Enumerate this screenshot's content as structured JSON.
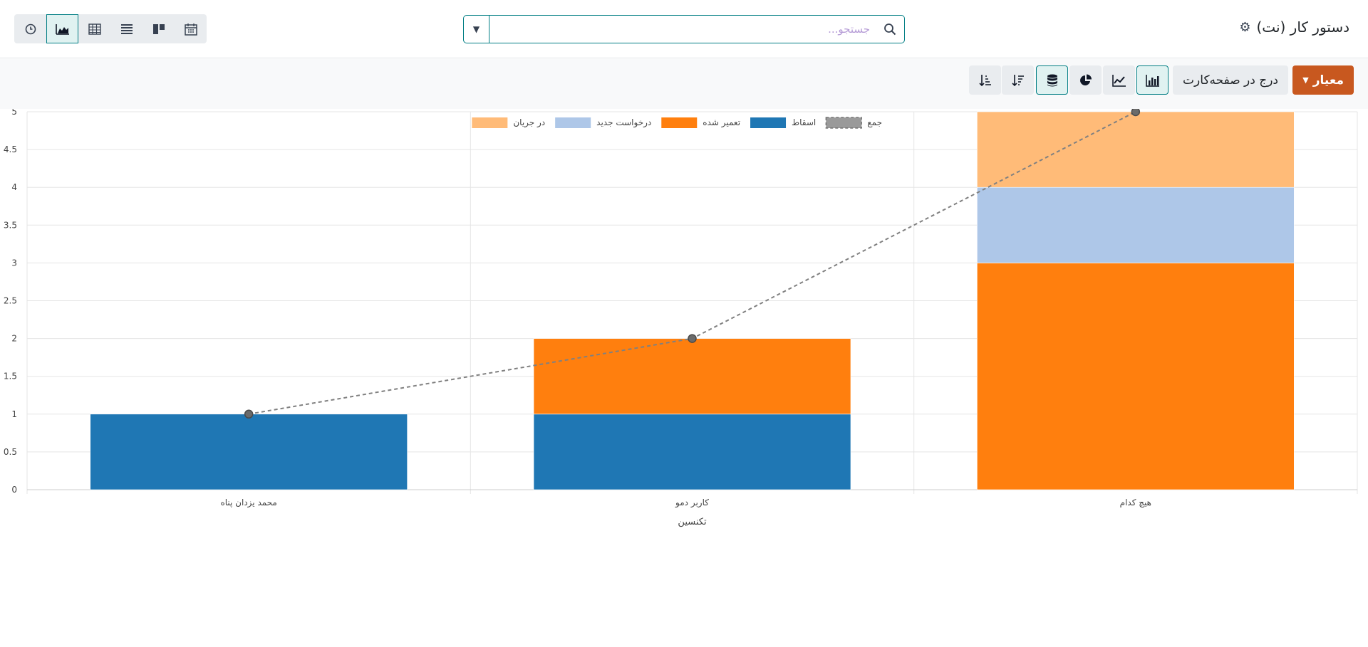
{
  "header": {
    "title": "دستور کار (نت)",
    "search_placeholder": "جستجو..."
  },
  "toolbar": {
    "criteria_label": "معیار",
    "insert_label": "درج در صفحه‌کارت"
  },
  "views": [
    "activity-view",
    "graph-view",
    "pivot-view",
    "list-view",
    "kanban-view",
    "calendar-view"
  ],
  "chart_data": {
    "type": "bar",
    "stacked": true,
    "categories": [
      "محمد یزدان پناه",
      "کاربر دمو",
      "هیچ کدام"
    ],
    "series": [
      {
        "name": "اسقاط",
        "color": "#1f77b4",
        "values": [
          1,
          1,
          0
        ]
      },
      {
        "name": "تعمیر شده",
        "color": "#ff7f0e",
        "values": [
          0,
          1,
          3
        ]
      },
      {
        "name": "درخواست جدید",
        "color": "#aec7e8",
        "values": [
          0,
          0,
          1
        ]
      },
      {
        "name": "در جریان",
        "color": "#ffbb78",
        "values": [
          0,
          0,
          1
        ]
      }
    ],
    "total_series": {
      "name": "جمع",
      "values": [
        1,
        2,
        5
      ],
      "color": "#808080",
      "style": "dashed"
    },
    "xlabel": "تکنسین",
    "ylabel": "",
    "ylim": [
      0,
      5
    ],
    "yticks": [
      "0",
      "0.5",
      "1",
      "1.5",
      "2",
      "2.5",
      "3",
      "3.5",
      "4",
      "4.5",
      "5"
    ],
    "grid": true,
    "legend_position": "top"
  }
}
